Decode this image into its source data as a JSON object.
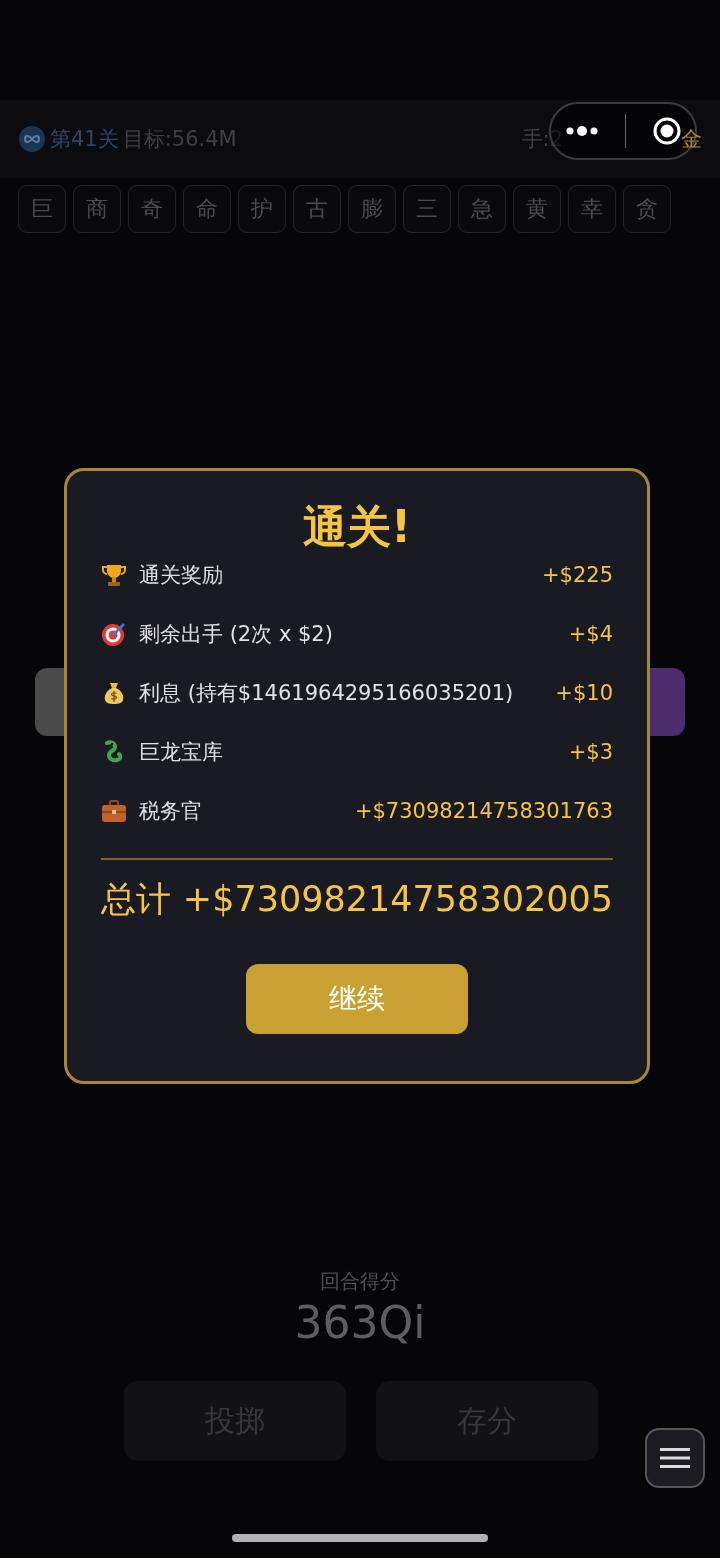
{
  "header": {
    "level_label": "第41关",
    "target": "目标:56.4M",
    "hands": "手:2",
    "gold_suffix": "金"
  },
  "chips": [
    "巨",
    "商",
    "奇",
    "命",
    "护",
    "古",
    "膨",
    "三",
    "急",
    "黄",
    "幸",
    "贪"
  ],
  "dice": [
    {
      "color": "#4a4a4a"
    },
    {
      "color": "#4c2d6e"
    }
  ],
  "modal": {
    "title": "通关!",
    "rows": [
      {
        "kind": "trophy",
        "label": "通关奖励",
        "value": "+$225"
      },
      {
        "kind": "target",
        "label": "剩余出手 (2次 x $2)",
        "value": "+$4"
      },
      {
        "kind": "moneybag",
        "label": "利息 (持有$1461964295166035201)",
        "value": "+$10"
      },
      {
        "kind": "dragon",
        "label": "巨龙宝库",
        "value": "+$3"
      },
      {
        "kind": "briefcase",
        "label": "税务官",
        "value": "+$73098214758301763"
      }
    ],
    "total_label": "总计",
    "total_value": "+$73098214758302005",
    "button": "继续"
  },
  "round_score": {
    "label": "回合得分",
    "value": "363Qi"
  },
  "actions": [
    "投掷",
    "存分"
  ]
}
